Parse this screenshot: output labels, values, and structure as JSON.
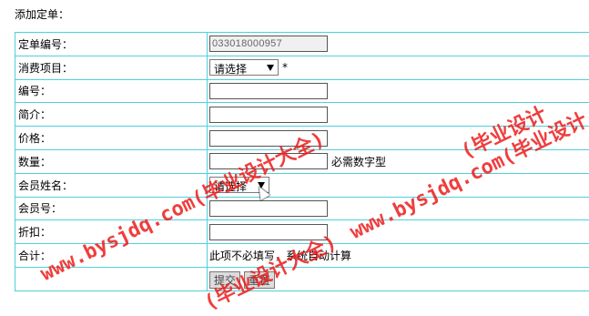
{
  "page": {
    "title": "添加定单："
  },
  "form": {
    "order_no_label": "定单编号：",
    "order_no_value": "033018000957",
    "item_label": "消费项目：",
    "item_select": "请选择",
    "required_mark": "*",
    "code_label": "编号：",
    "intro_label": "简介：",
    "price_label": "价格：",
    "qty_label": "数量：",
    "qty_hint": "必需数字型",
    "member_name_label": "会员姓名：",
    "member_select": "请选择",
    "member_no_label": "会员号：",
    "discount_label": "折扣：",
    "total_label": "合计：",
    "total_hint": "此项不必填写，系统自动计算",
    "submit_label": "提交",
    "reset_label": "重置"
  },
  "watermarks": [
    "www.bysjdq.com(毕业设计大全)",
    "www.bysjdq.com(毕业设计",
    "(毕业设计",
    "(毕业设计大全)"
  ]
}
